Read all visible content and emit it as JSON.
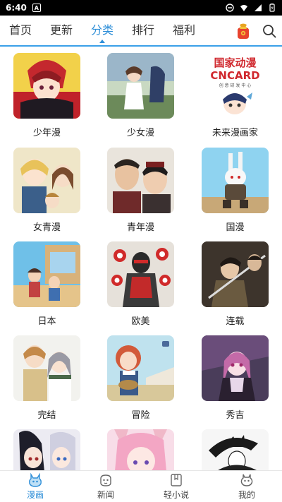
{
  "status_bar": {
    "time": "6:40",
    "notification_letter": "A"
  },
  "top_nav": {
    "tabs": [
      {
        "label": "首页",
        "active": false
      },
      {
        "label": "更新",
        "active": false
      },
      {
        "label": "分类",
        "active": true
      },
      {
        "label": "排行",
        "active": false
      },
      {
        "label": "福利",
        "active": false
      }
    ],
    "accent_color": "#2f8fd8"
  },
  "categories": [
    {
      "label": "少年漫",
      "art": "red-haired-boy"
    },
    {
      "label": "少女漫",
      "art": "girl-in-field"
    },
    {
      "label": "未来漫画家",
      "art": "cncard-logo",
      "art_text": [
        "国家动漫",
        "CNCARD",
        "创 意 研 发 中 心"
      ]
    },
    {
      "label": "女青漫",
      "art": "blonde-noble"
    },
    {
      "label": "青年漫",
      "art": "two-men"
    },
    {
      "label": "国漫",
      "art": "rabbit-warrior"
    },
    {
      "label": "日本",
      "art": "family-porch"
    },
    {
      "label": "欧美",
      "art": "targets-figure"
    },
    {
      "label": "连载",
      "art": "swordsman"
    },
    {
      "label": "完结",
      "art": "couple"
    },
    {
      "label": "冒险",
      "art": "red-haired-girl"
    },
    {
      "label": "秀吉",
      "art": "purple-girl"
    },
    {
      "label": "",
      "art": "dark-haired-girls"
    },
    {
      "label": "",
      "art": "pink-girl"
    },
    {
      "label": "",
      "art": "sketch-figure"
    }
  ],
  "bottom_nav": [
    {
      "label": "漫画",
      "icon": "comic-icon",
      "active": true
    },
    {
      "label": "新闻",
      "icon": "news-icon",
      "active": false
    },
    {
      "label": "轻小说",
      "icon": "novel-icon",
      "active": false
    },
    {
      "label": "我的",
      "icon": "profile-icon",
      "active": false
    }
  ]
}
